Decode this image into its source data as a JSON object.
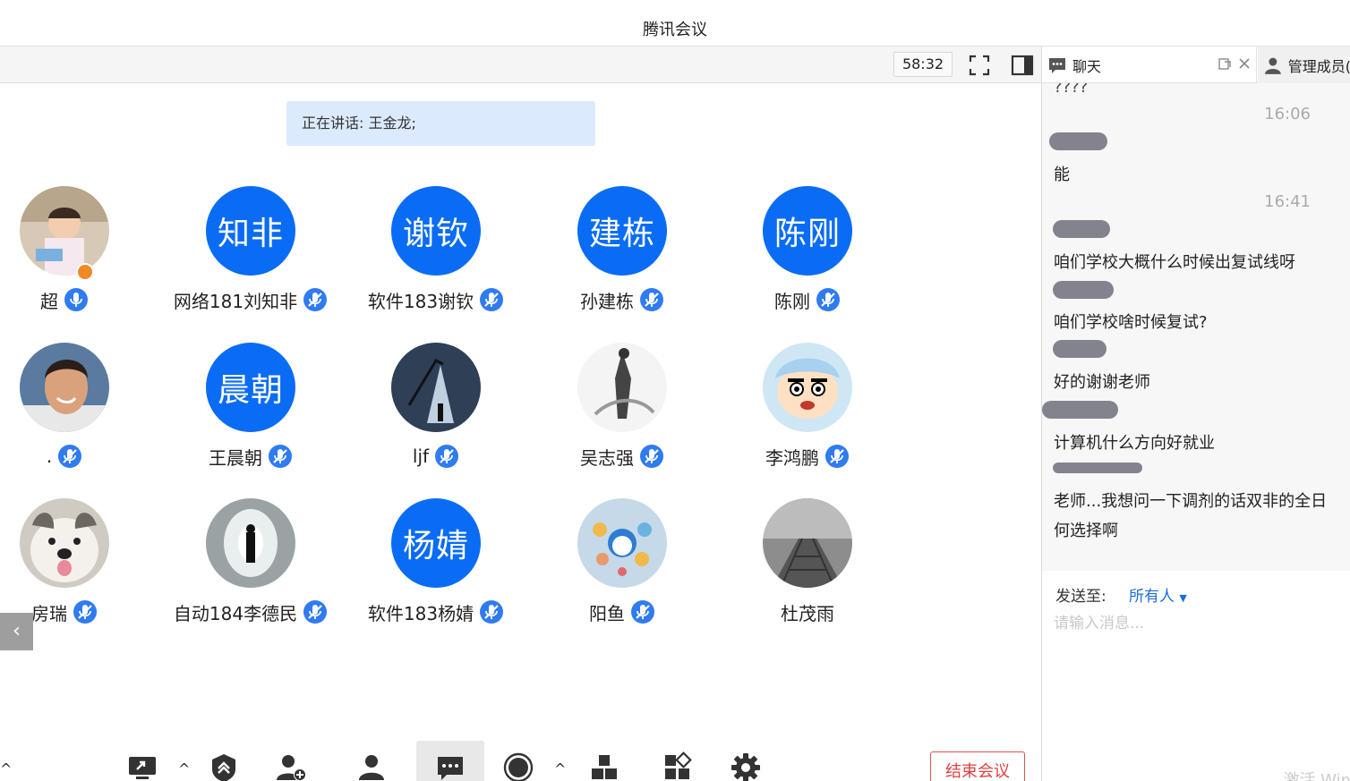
{
  "window": {
    "title": "腾讯会议"
  },
  "toolbar": {
    "timer": "58:32"
  },
  "speaking": {
    "text": "正在讲话: 王金龙;"
  },
  "participants": [
    {
      "name": "超",
      "avatar_type": "photo",
      "avatar_desc": "baby"
    },
    {
      "name": "网络181刘知非",
      "avatar_type": "text",
      "avatar_text": "知非"
    },
    {
      "name": "软件183谢钦",
      "avatar_type": "text",
      "avatar_text": "谢钦"
    },
    {
      "name": "孙建栋",
      "avatar_type": "text",
      "avatar_text": "建栋"
    },
    {
      "name": "陈刚",
      "avatar_type": "text",
      "avatar_text": "陈刚"
    },
    {
      "name": ".",
      "avatar_type": "photo",
      "avatar_desc": "man"
    },
    {
      "name": "王晨朝",
      "avatar_type": "text",
      "avatar_text": "晨朝"
    },
    {
      "name": "ljf",
      "avatar_type": "photo",
      "avatar_desc": "lamp"
    },
    {
      "name": "吴志强",
      "avatar_type": "photo",
      "avatar_desc": "figure"
    },
    {
      "name": "李鸿鹏",
      "avatar_type": "photo",
      "avatar_desc": "cartoon"
    },
    {
      "name": "房瑞",
      "avatar_type": "photo",
      "avatar_desc": "dog"
    },
    {
      "name": "自动184李德民",
      "avatar_type": "photo",
      "avatar_desc": "tunnel"
    },
    {
      "name": "软件183杨婧",
      "avatar_type": "text",
      "avatar_text": "杨婧"
    },
    {
      "name": "阳鱼",
      "avatar_type": "photo",
      "avatar_desc": "doraemon"
    },
    {
      "name": "杜茂雨",
      "avatar_type": "photo",
      "avatar_desc": "pier"
    }
  ],
  "side_arrow": "‹",
  "bottom": {
    "end_meeting": "结束会议"
  },
  "panel": {
    "tab_chat": "聊天",
    "tab_members": "管理成员(",
    "chat": {
      "partial_top": "????",
      "time1": "16:06",
      "msg1": "能",
      "time2": "16:41",
      "msg2": "咱们学校大概什么时候出复试线呀",
      "msg3": "咱们学校啥时候复试?",
      "msg4": "好的谢谢老师",
      "msg5": "计算机什么方向好就业",
      "msg6_line1": "老师...我想问一下调剂的话双非的全日",
      "msg6_line2": "何选择啊"
    },
    "send_to_label": "发送至:",
    "send_to_value": "所有人",
    "input_placeholder": "请输入消息...",
    "watermark": "激活 Win"
  },
  "colors": {
    "accent": "#0a6cf5",
    "speaking_bg": "#dbeafc",
    "end_red": "#e04040"
  }
}
